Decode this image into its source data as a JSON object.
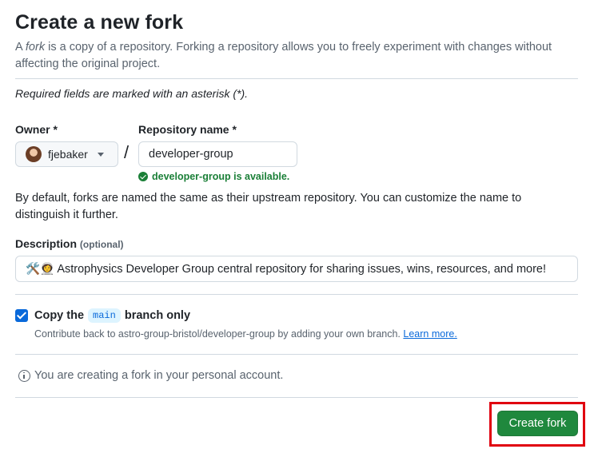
{
  "header": {
    "title": "Create a new fork",
    "intro_prefix": "A ",
    "intro_fork": "fork",
    "intro_rest": " is a copy of a repository. Forking a repository allows you to freely experiment with changes without affecting the original project."
  },
  "form": {
    "required_note": "Required fields are marked with an asterisk (*).",
    "owner": {
      "label": "Owner *",
      "value": "fjebaker",
      "icon": "avatar"
    },
    "repository": {
      "label": "Repository name *",
      "value": "developer-group",
      "availability": "developer-group is available."
    },
    "default_note": "By default, forks are named the same as their upstream repository. You can customize the name to distinguish it further.",
    "description": {
      "label": "Description",
      "optional": "(optional)",
      "value": "🛠️👩‍🚀 Astrophysics Developer Group central repository for sharing issues, wins, resources, and more!"
    },
    "copy_branch": {
      "checked": true,
      "label_prefix": "Copy the",
      "branch": "main",
      "label_suffix": "branch only",
      "help": "Contribute back to astro-group-bristol/developer-group by adding your own branch.",
      "learn_more": "Learn more."
    },
    "account_note": "You are creating a fork in your personal account.",
    "submit_label": "Create fork"
  },
  "colors": {
    "primary_button": "#1f883d",
    "success": "#1a7f37",
    "link": "#0969da",
    "highlight_box": "#e0000f"
  }
}
